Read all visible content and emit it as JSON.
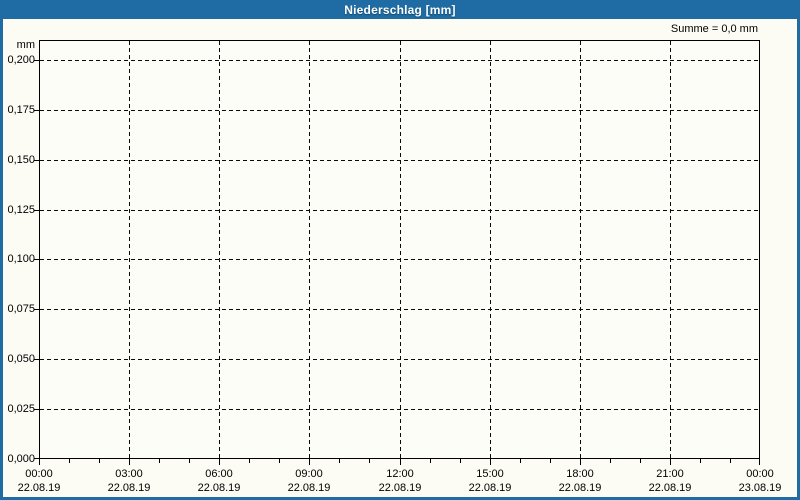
{
  "window": {
    "title": "Niederschlag [mm]"
  },
  "summary": {
    "text": "Summe = 0,0 mm"
  },
  "colors": {
    "titlebar": "#1E6CA3",
    "frame": "#1E6CA3",
    "background": "#FCFCF5",
    "plot_background": "#FDFDF8",
    "grid": "#0A0A0A",
    "axis": "#000000",
    "title_text": "#FFFFFF",
    "label_text": "#000000"
  },
  "chart_data": {
    "type": "bar",
    "title": "Niederschlag [mm]",
    "ylabel": "mm",
    "xlabel": "",
    "grid": true,
    "ylim": [
      0,
      0.21
    ],
    "xlim_hours": [
      0,
      24
    ],
    "minor_x_tick_every_hours": 1,
    "y_ticks": [
      {
        "label": "0,200",
        "value": 0.2
      },
      {
        "label": "0,175",
        "value": 0.175
      },
      {
        "label": "0,150",
        "value": 0.15
      },
      {
        "label": "0,125",
        "value": 0.125
      },
      {
        "label": "0,100",
        "value": 0.1
      },
      {
        "label": "0,075",
        "value": 0.075
      },
      {
        "label": "0,050",
        "value": 0.05
      },
      {
        "label": "0,025",
        "value": 0.025
      },
      {
        "label": "0,000",
        "value": 0.0
      }
    ],
    "x_ticks": [
      {
        "hour": 0,
        "time": "00:00",
        "date": "22.08.19"
      },
      {
        "hour": 3,
        "time": "03:00",
        "date": "22.08.19"
      },
      {
        "hour": 6,
        "time": "06:00",
        "date": "22.08.19"
      },
      {
        "hour": 9,
        "time": "09:00",
        "date": "22.08.19"
      },
      {
        "hour": 12,
        "time": "12:00",
        "date": "22.08.19"
      },
      {
        "hour": 15,
        "time": "15:00",
        "date": "22.08.19"
      },
      {
        "hour": 18,
        "time": "18:00",
        "date": "22.08.19"
      },
      {
        "hour": 21,
        "time": "21:00",
        "date": "22.08.19"
      },
      {
        "hour": 24,
        "time": "00:00",
        "date": "23.08.19"
      }
    ],
    "series": [
      {
        "name": "Niederschlag",
        "sum_label": "Summe = 0,0 mm",
        "values": []
      }
    ],
    "annotations": [
      "Summe = 0,0 mm"
    ]
  }
}
